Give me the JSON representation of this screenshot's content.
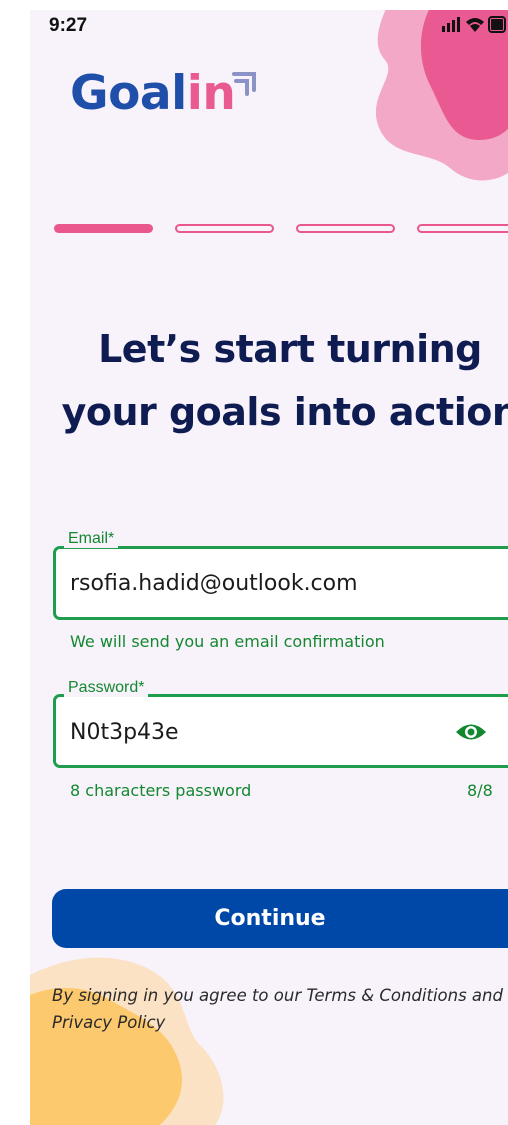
{
  "status_bar": {
    "time": "9:27",
    "icons": [
      "signal-icon",
      "wifi-icon",
      "battery-icon"
    ]
  },
  "logo": {
    "part1": "Goal",
    "part2": "in"
  },
  "progress": {
    "total_steps": 4,
    "current_step": 1
  },
  "headline": {
    "line1": "Let’s start turning",
    "line2": "your goals into action"
  },
  "email": {
    "label": "Email*",
    "value": "rsofia.hadid@outlook.com",
    "helper": "We will send you an email confirmation"
  },
  "password": {
    "label": "Password*",
    "value": "N0t3p43e",
    "helper": "8 characters password",
    "counter": "8/8",
    "icon": "eye-icon"
  },
  "continue_label": "Continue",
  "terms": "By signing in you agree to our Terms & Conditions and Privacy Policy",
  "colors": {
    "brand_blue": "#0048a8",
    "brand_pink": "#e9578d",
    "success_green": "#1f9c4c",
    "headline_navy": "#0e1c52",
    "background": "#f8f2fa"
  }
}
